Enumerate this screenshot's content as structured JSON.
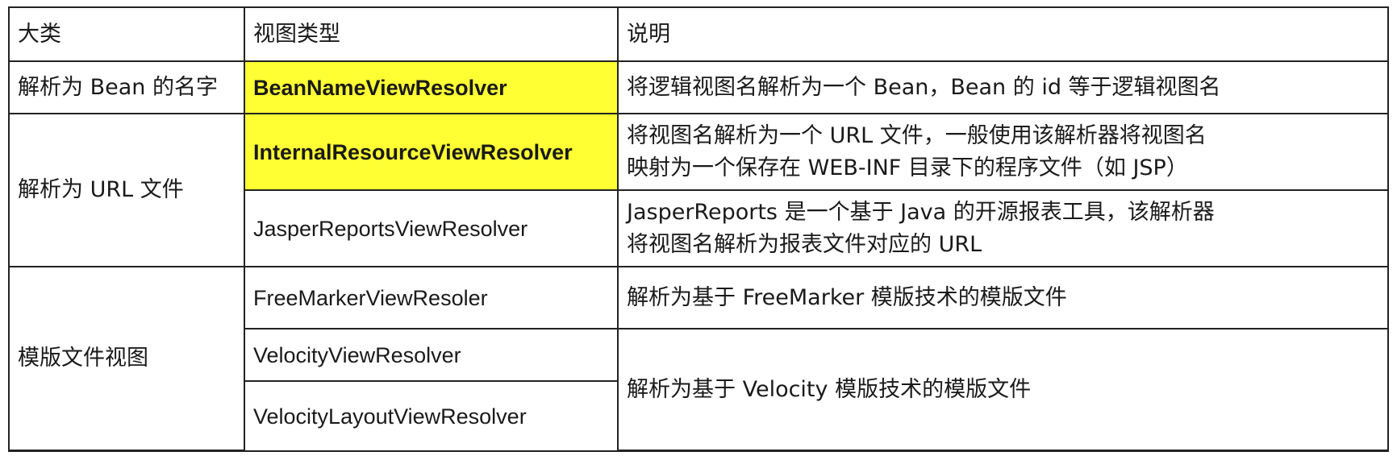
{
  "table": {
    "headers": {
      "category": "大类",
      "view_type": "视图类型",
      "description": "说明"
    },
    "highlight_color": "#ffff33",
    "row1": {
      "category": "解析为 Bean 的名字",
      "resolver": "BeanNameViewResolver",
      "description": "将逻辑视图名解析为一个 Bean，Bean 的 id 等于逻辑视图名"
    },
    "row2": {
      "category": "解析为 URL 文件",
      "resolver": "InternalResourceViewResolver",
      "description_line1": "将视图名解析为一个 URL 文件，一般使用该解析器将视图名",
      "description_line2": "映射为一个保存在 WEB-INF 目录下的程序文件（如 JSP）"
    },
    "row3": {
      "resolver": "JasperReportsViewResolver",
      "description_line1": "JasperReports 是一个基于 Java 的开源报表工具，该解析器",
      "description_line2": "将视图名解析为报表文件对应的 URL"
    },
    "row4": {
      "category": "模版文件视图",
      "resolver": "FreeMarkerViewResoler",
      "description": "解析为基于 FreeMarker 模版技术的模版文件"
    },
    "row5": {
      "resolver": "VelocityViewResolver",
      "description": "解析为基于 Velocity 模版技术的模版文件"
    },
    "row6": {
      "resolver": "VelocityLayoutViewResolver"
    }
  }
}
